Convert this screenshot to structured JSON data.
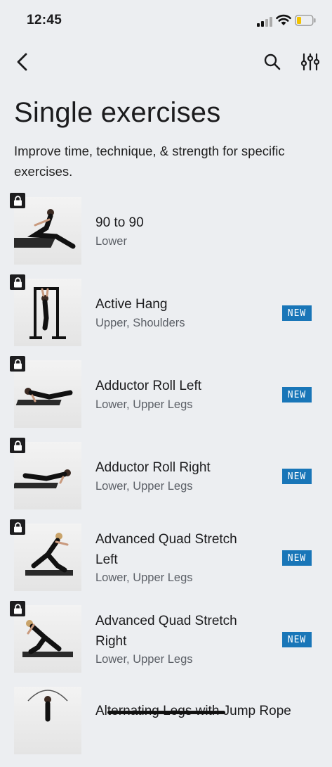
{
  "status": {
    "time": "12:45"
  },
  "nav": {
    "back_icon": "chevron-left-icon",
    "search_icon": "search-icon",
    "filter_icon": "sliders-icon"
  },
  "header": {
    "title": "Single exercises",
    "subtitle": "Improve time, technique, & strength for specific exercises."
  },
  "badge_label": "NEW",
  "colors": {
    "background": "#eceef1",
    "badge": "#1976b8",
    "lock": "#1d1d1f"
  },
  "exercises": [
    {
      "name": "90 to 90",
      "category": "Lower",
      "is_new": false,
      "locked": true
    },
    {
      "name": "Active Hang",
      "category": "Upper, Shoulders",
      "is_new": true,
      "locked": true
    },
    {
      "name": "Adductor Roll Left",
      "category": "Lower, Upper Legs",
      "is_new": true,
      "locked": true
    },
    {
      "name": "Adductor Roll Right",
      "category": "Lower, Upper Legs",
      "is_new": true,
      "locked": true
    },
    {
      "name": "Advanced Quad Stretch Left",
      "category": "Lower, Upper Legs",
      "is_new": true,
      "locked": true
    },
    {
      "name": "Advanced Quad Stretch Right",
      "category": "Lower, Upper Legs",
      "is_new": true,
      "locked": true
    },
    {
      "name": "Alternating Legs with Jump Rope",
      "category": "",
      "is_new": false,
      "locked": false
    }
  ]
}
